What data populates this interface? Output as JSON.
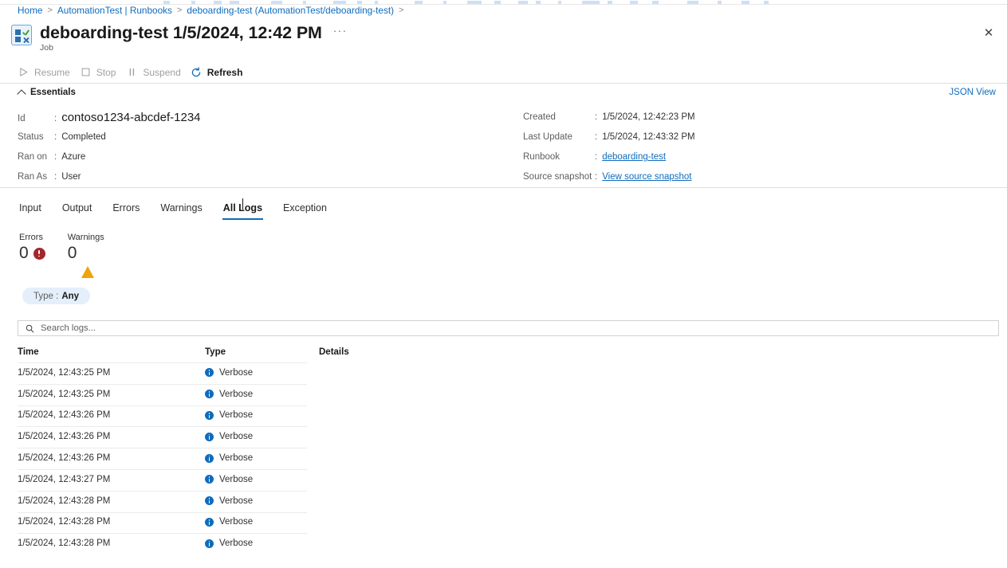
{
  "breadcrumb": {
    "items": [
      {
        "label": "Home"
      },
      {
        "label": "AutomationTest | Runbooks"
      },
      {
        "label": "deboarding-test (AutomationTest/deboarding-test)"
      }
    ],
    "separator": ">"
  },
  "header": {
    "title": "deboarding-test 1/5/2024, 12:42 PM",
    "subtitle": "Job",
    "icon": "job-icon",
    "more_label": "···",
    "close_label": "✕"
  },
  "commandbar": {
    "items": [
      {
        "label": "Resume",
        "icon": "play-icon",
        "enabled": false
      },
      {
        "label": "Stop",
        "icon": "stop-square-icon",
        "enabled": false
      },
      {
        "label": "Suspend",
        "icon": "pause-icon",
        "enabled": false
      },
      {
        "label": "Refresh",
        "icon": "refresh-icon",
        "enabled": true
      }
    ]
  },
  "essentials": {
    "header": "Essentials",
    "json_view_label": "JSON View",
    "left": [
      {
        "label": "Id",
        "value": "contoso1234-abcdef-1234",
        "big": true
      },
      {
        "label": "Status",
        "value": "Completed"
      },
      {
        "label": "Ran on",
        "value": "Azure"
      },
      {
        "label": "Ran As",
        "value": "User"
      }
    ],
    "right": [
      {
        "label": "Created",
        "value": "1/5/2024, 12:42:23 PM",
        "link": false
      },
      {
        "label": "Last Update",
        "value": "1/5/2024, 12:43:32 PM",
        "link": false
      },
      {
        "label": "Runbook",
        "value": "deboarding-test",
        "link": true
      },
      {
        "label": "Source snapshot",
        "value": "View source snapshot",
        "link": true
      }
    ]
  },
  "tabs": [
    {
      "label": "Input",
      "active": false
    },
    {
      "label": "Output",
      "active": false
    },
    {
      "label": "Errors",
      "active": false
    },
    {
      "label": "Warnings",
      "active": false
    },
    {
      "label": "All Logs",
      "active": true
    },
    {
      "label": "Exception",
      "active": false
    }
  ],
  "counters": [
    {
      "label": "Errors",
      "value": "0",
      "icon": "error-circle-icon",
      "color": "#a4262c"
    },
    {
      "label": "Warnings",
      "value": "0",
      "icon": "warning-triangle-icon",
      "color": "#f0a30a"
    }
  ],
  "filter": {
    "label": "Type :",
    "value": "Any"
  },
  "search": {
    "placeholder": "Search logs...",
    "value": "",
    "icon": "search-icon"
  },
  "table": {
    "columns": [
      "Time",
      "Type",
      "Details"
    ],
    "rows": [
      {
        "time": "1/5/2024, 12:43:25 PM",
        "type": "Verbose",
        "details": ""
      },
      {
        "time": "1/5/2024, 12:43:25 PM",
        "type": "Verbose",
        "details": ""
      },
      {
        "time": "1/5/2024, 12:43:26 PM",
        "type": "Verbose",
        "details": ""
      },
      {
        "time": "1/5/2024, 12:43:26 PM",
        "type": "Verbose",
        "details": ""
      },
      {
        "time": "1/5/2024, 12:43:26 PM",
        "type": "Verbose",
        "details": ""
      },
      {
        "time": "1/5/2024, 12:43:27 PM",
        "type": "Verbose",
        "details": ""
      },
      {
        "time": "1/5/2024, 12:43:28 PM",
        "type": "Verbose",
        "details": ""
      },
      {
        "time": "1/5/2024, 12:43:28 PM",
        "type": "Verbose",
        "details": ""
      },
      {
        "time": "1/5/2024, 12:43:28 PM",
        "type": "Verbose",
        "details": ""
      }
    ]
  },
  "colors": {
    "accent": "#0f6cbd",
    "error": "#a4262c",
    "warning": "#f0a30a",
    "pill_bg": "#e4effb"
  }
}
